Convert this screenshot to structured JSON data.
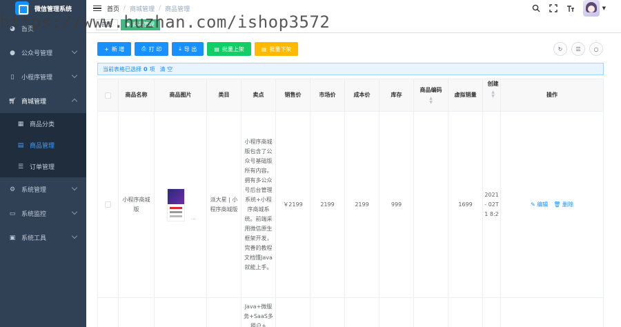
{
  "app": {
    "title": "微信管理系统"
  },
  "sidebar": {
    "items": [
      {
        "label": "首页",
        "icon": "dashboard-icon"
      },
      {
        "label": "公众号管理",
        "icon": "wechat-icon"
      },
      {
        "label": "小程序管理",
        "icon": "mobile-icon"
      },
      {
        "label": "商城管理",
        "icon": "cart-icon",
        "children": [
          {
            "label": "商品分类",
            "icon": "table-icon"
          },
          {
            "label": "商品管理",
            "icon": "shopping-icon"
          },
          {
            "label": "订单管理",
            "icon": "list-icon"
          }
        ]
      },
      {
        "label": "系统管理",
        "icon": "gear-icon"
      },
      {
        "label": "系统监控",
        "icon": "monitor-icon"
      },
      {
        "label": "系统工具",
        "icon": "toolbox-icon"
      }
    ]
  },
  "breadcrumb": [
    "首页",
    "商城管理",
    "商品管理"
  ],
  "tags": [
    "首页",
    "商品管理"
  ],
  "toolbar": {
    "add": "新 增",
    "print": "打 印",
    "export": "导 出",
    "batch_on": "批量上架",
    "batch_off": "批量下架"
  },
  "selection": {
    "prefix": "当前表格已选择",
    "count": "0",
    "suffix": "项",
    "clear": "清 空"
  },
  "table": {
    "headers": [
      "商品名称",
      "商品图片",
      "类目",
      "卖点",
      "销售价",
      "市场价",
      "成本价",
      "库存",
      "商品编码",
      "虚拟销量",
      "创建",
      "操作"
    ],
    "rows": [
      {
        "name": "小程序商城版",
        "category": "派大星 | 小程序商城版",
        "selling": "小程序商城版包含了公众号基础版所有内容。拥有多公众号后台管理系统+小程序商城系统。前端采用微信原生框架开发，完善的教程文档懂Java就能上手。",
        "sale_price": "￥2199",
        "market_price": "2199",
        "cost_price": "2199",
        "stock": "999",
        "code": "",
        "virtual_sales": "1699",
        "created": "2021- 02T1 8:2",
        "edit": "编辑",
        "delete": "删除"
      },
      {
        "selling": "Java+微服务+SaaS多租户+"
      }
    ]
  },
  "watermark": "https://www.huzhan.com/ishop3572",
  "colors": {
    "primary": "#1890ff",
    "success": "#13ce66",
    "warning": "#ffba00",
    "sidebar": "#304156",
    "danger": "#f56c6c"
  }
}
